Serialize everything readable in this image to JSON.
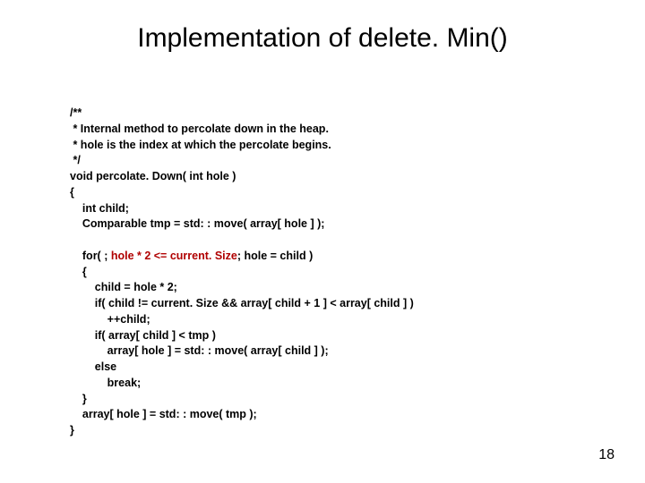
{
  "title": "Implementation of delete. Min()",
  "code": {
    "l1": "/**",
    "l2": " * Internal method to percolate down in the heap.",
    "l3": " * hole is the index at which the percolate begins.",
    "l4": " */",
    "l5": "void percolate. Down( int hole )",
    "l6": "{",
    "l7": "    int child;",
    "l8": "    Comparable tmp = std: : move( array[ hole ] );",
    "l9_a": "    for( ; ",
    "l9_b": "hole * 2 <= current. Size",
    "l9_c": "; hole = child )",
    "l10": "    {",
    "l11": "        child = hole * 2;",
    "l12": "        if( child != current. Size && array[ child + 1 ] < array[ child ] )",
    "l13": "            ++child;",
    "l14": "        if( array[ child ] < tmp )",
    "l15": "            array[ hole ] = std: : move( array[ child ] );",
    "l16": "        else",
    "l17": "            break;",
    "l18": "    }",
    "l19": "    array[ hole ] = std: : move( tmp );",
    "l20": "}"
  },
  "page_number": "18"
}
